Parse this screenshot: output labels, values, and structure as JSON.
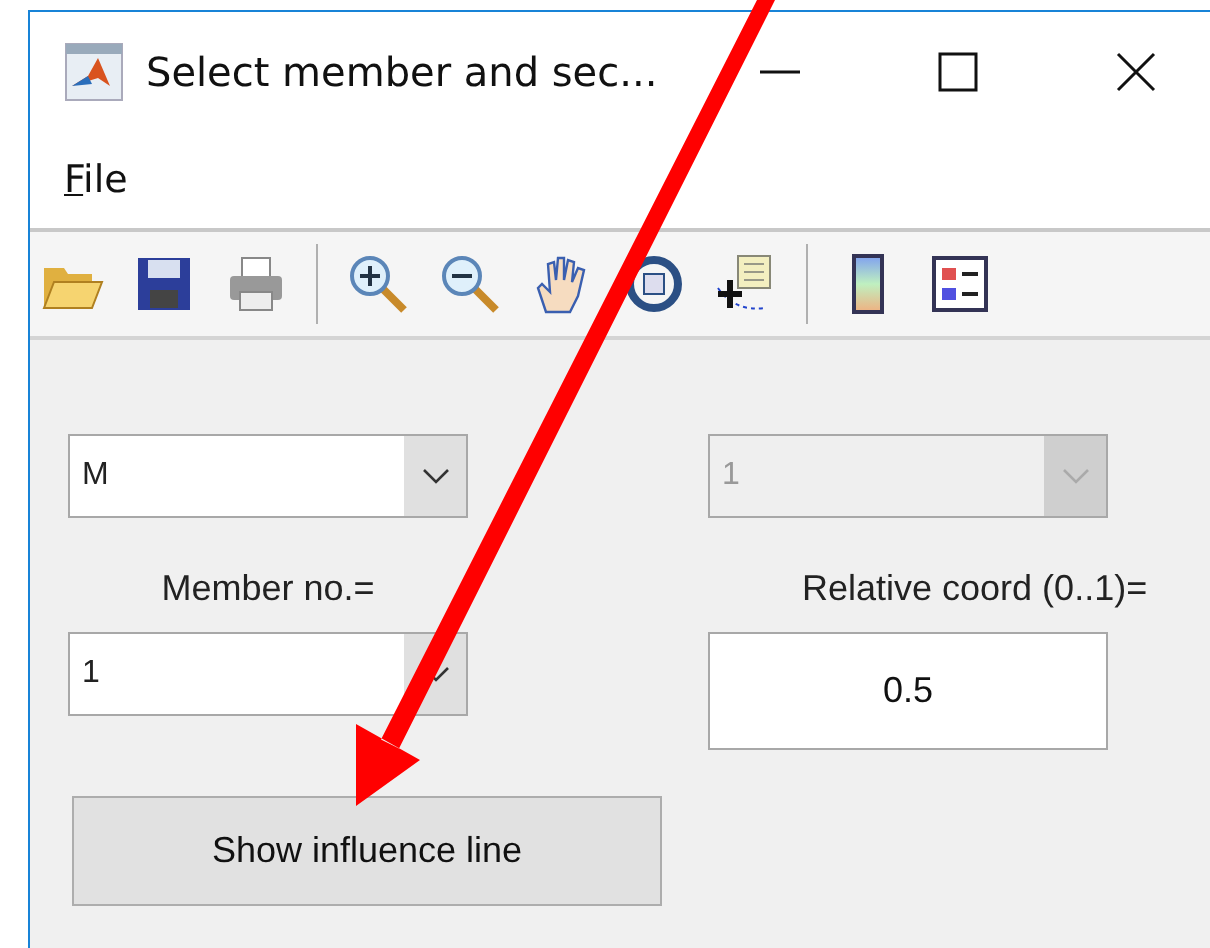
{
  "window": {
    "title": "Select member and sec..."
  },
  "menu": [
    {
      "label": "File"
    }
  ],
  "result_dropdown": {
    "value": "M",
    "disabled": false
  },
  "section_dropdown": {
    "value": "1",
    "disabled": true
  },
  "member_label": "Member no.=",
  "coord_label": "Relative coord (0..1)=",
  "member_dropdown": {
    "value": "1",
    "disabled": false
  },
  "coord_field": {
    "value": "0.5"
  },
  "show_button": {
    "label": "Show influence line"
  }
}
